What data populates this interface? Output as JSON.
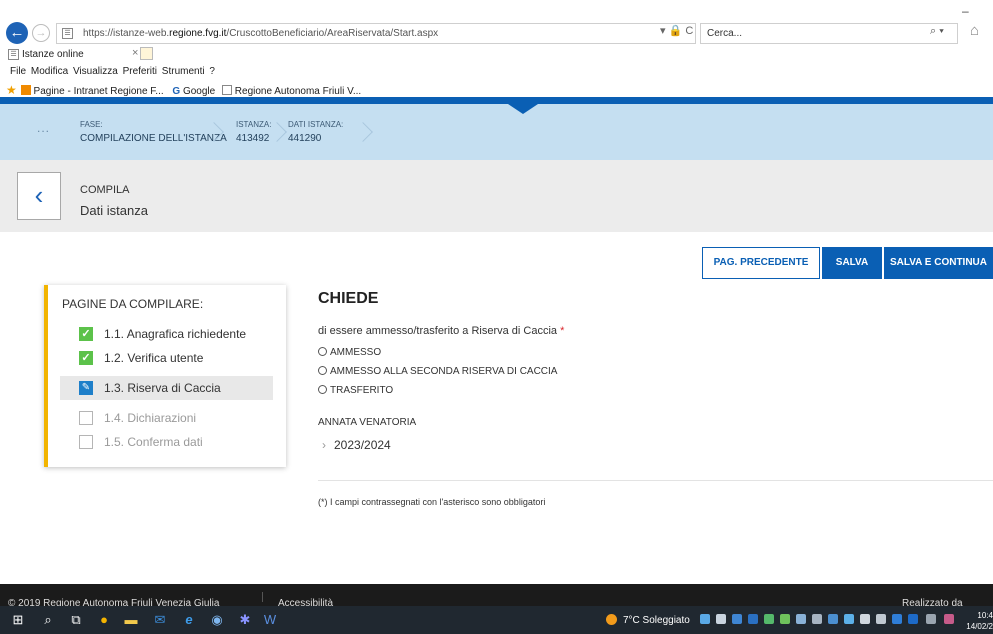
{
  "browser": {
    "url_prefix": "https://istanze-web.",
    "url_host": "regione.fvg.it",
    "url_path": "/CruscottoBeneficiario/AreaRiservata/Start.aspx",
    "addr_tools": "▾ 🔒 C",
    "search_placeholder": "Cerca...",
    "search_tools": "⌕ ▾",
    "minimize": "–",
    "home_icon": "⌂",
    "tab_title": "Istanze online",
    "tab_close": "×",
    "menu": [
      "File",
      "Modifica",
      "Visualizza",
      "Preferiti",
      "Strumenti",
      "?"
    ],
    "favorites": [
      "Pagine - Intranet Regione F...",
      "Google",
      "Regione Autonoma Friuli V..."
    ]
  },
  "phase": {
    "dots": "...",
    "fase_label": "FASE:",
    "fase_value": "COMPILAZIONE DELL'ISTANZA",
    "istanza_label": "ISTANZA:",
    "istanza_value": "413492",
    "dati_label": "DATI ISTANZA:",
    "dati_value": "441290"
  },
  "compile": {
    "back_icon": "‹",
    "label": "COMPILA",
    "title": "Dati istanza"
  },
  "actions": {
    "prev": "PAG. PRECEDENTE",
    "save": "SALVA",
    "save_continue": "SALVA E CONTINUA"
  },
  "pages": {
    "title": "PAGINE DA COMPILARE:",
    "items": [
      {
        "label": "1.1. Anagrafica richiedente",
        "state": "done"
      },
      {
        "label": "1.2. Verifica utente",
        "state": "done"
      },
      {
        "label": "1.3. Riserva di Caccia",
        "state": "current"
      },
      {
        "label": "1.4. Dichiarazioni",
        "state": "todo"
      },
      {
        "label": "1.5. Conferma dati",
        "state": "todo"
      }
    ]
  },
  "form": {
    "heading": "CHIEDE",
    "question": "di essere ammesso/trasferito a Riserva di Caccia",
    "required_mark": "*",
    "options": [
      "AMMESSO",
      "AMMESSO ALLA SECONDA RISERVA DI CACCIA",
      "TRASFERITO"
    ],
    "annata_label": "ANNATA VENATORIA",
    "annata_value": "2023/2024",
    "note": "(*) I campi contrassegnati con l'asterisco sono obbligatori"
  },
  "footer": {
    "copyright": "© 2019 Regione Autonoma Friuli Venezia Giulia",
    "accessibility": "Accessibilità",
    "right": "Realizzato da"
  },
  "taskbar": {
    "weather": "7°C Soleggiato",
    "time": "10:4",
    "date": "14/02/2"
  }
}
